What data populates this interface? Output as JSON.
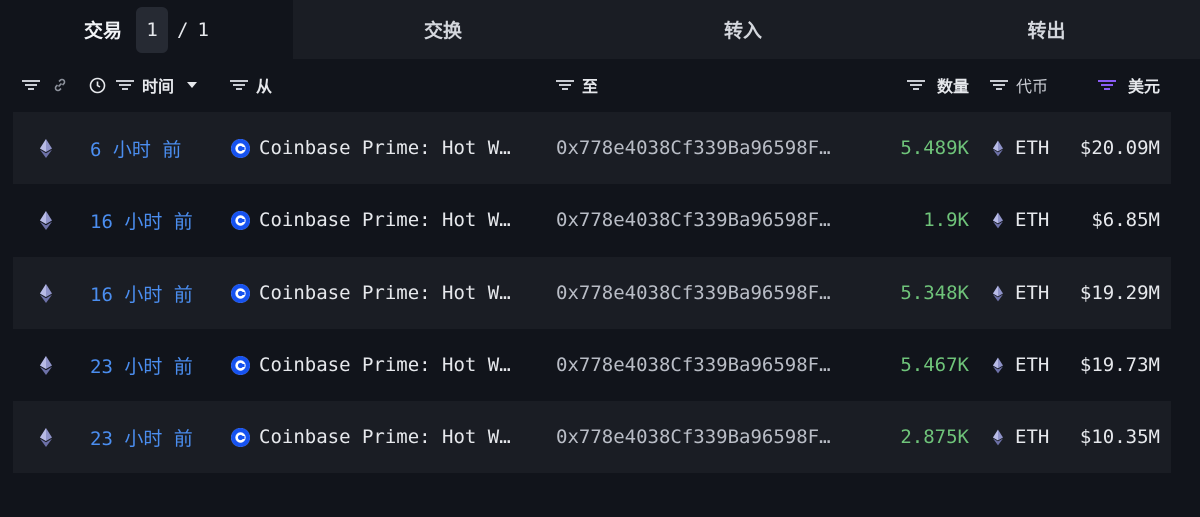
{
  "tabs": {
    "transactions": "交易",
    "page_current": "1",
    "page_sep": "/",
    "page_total": "1",
    "swaps": "交换",
    "inflow": "转入",
    "outflow": "转出"
  },
  "columns": {
    "time": "时间",
    "from": "从",
    "to": "至",
    "amount": "数量",
    "token": "代币",
    "usd": "美元"
  },
  "colors": {
    "accent_blue": "#4b8ef0",
    "amount_green": "#6fc47a",
    "usd_filter_purple": "#8b5cf6"
  },
  "rows": [
    {
      "time": "6 小时 前",
      "from": "Coinbase Prime: Hot W…",
      "to": "0x778e4038Cf339Ba96598F…",
      "amount": "5.489K",
      "token": "ETH",
      "usd": "$20.09M"
    },
    {
      "time": "16 小时 前",
      "from": "Coinbase Prime: Hot W…",
      "to": "0x778e4038Cf339Ba96598F…",
      "amount": "1.9K",
      "token": "ETH",
      "usd": "$6.85M"
    },
    {
      "time": "16 小时 前",
      "from": "Coinbase Prime: Hot W…",
      "to": "0x778e4038Cf339Ba96598F…",
      "amount": "5.348K",
      "token": "ETH",
      "usd": "$19.29M"
    },
    {
      "time": "23 小时 前",
      "from": "Coinbase Prime: Hot W…",
      "to": "0x778e4038Cf339Ba96598F…",
      "amount": "5.467K",
      "token": "ETH",
      "usd": "$19.73M"
    },
    {
      "time": "23 小时 前",
      "from": "Coinbase Prime: Hot W…",
      "to": "0x778e4038Cf339Ba96598F…",
      "amount": "2.875K",
      "token": "ETH",
      "usd": "$10.35M"
    }
  ]
}
